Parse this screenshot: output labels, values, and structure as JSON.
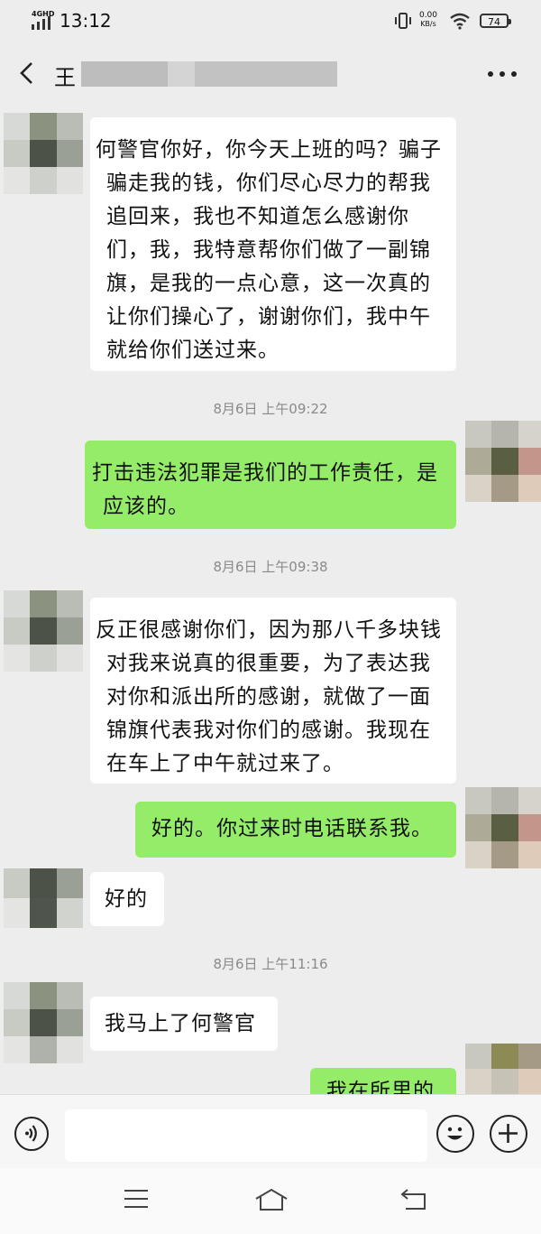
{
  "status_bar": {
    "network": "4GHD",
    "time": "13:12",
    "net_speed_value": "0.00",
    "net_speed_unit": "KB/s",
    "battery": "74"
  },
  "header": {
    "title": "王"
  },
  "messages": [
    {
      "side": "in",
      "text": "何警官你好，你今天上班的吗？骗子骗走我的钱，你们尽心尽力的帮我追回来，我也不知道怎么感谢你们，我，我特意帮你们做了一副锦旗，是我的一点心意，这一次真的让你们操心了，谢谢你们，我中午就给你们送过来。"
    },
    {
      "side": "out",
      "text": "打击违法犯罪是我们的工作责任，是应该的。"
    },
    {
      "side": "in",
      "text": "反正很感谢你们，因为那八千多块钱对我来说真的很重要，为了表达我对你和派出所的感谢，就做了一面锦旗代表我对你们的感谢。我现在在车上了中午就过来了。"
    },
    {
      "side": "out",
      "text": "好的。你过来时电话联系我。"
    },
    {
      "side": "in",
      "text": "好的"
    },
    {
      "side": "in",
      "text": "我马上了何警官"
    },
    {
      "side": "out",
      "text": "我在所里的"
    }
  ],
  "timestamps": [
    "8月6日 上午09:22",
    "8月6日 上午09:38",
    "8月6日 上午11:16"
  ],
  "icons": {
    "back": "back-arrow-icon",
    "more": "more-dots-icon",
    "voice": "voice-icon",
    "emoji": "emoji-icon",
    "plus": "plus-icon",
    "menu": "menu-icon",
    "home": "home-icon",
    "return": "return-icon"
  },
  "colors": {
    "background": "#ededed",
    "outgoing_bubble": "#95ec69",
    "incoming_bubble": "#ffffff"
  }
}
